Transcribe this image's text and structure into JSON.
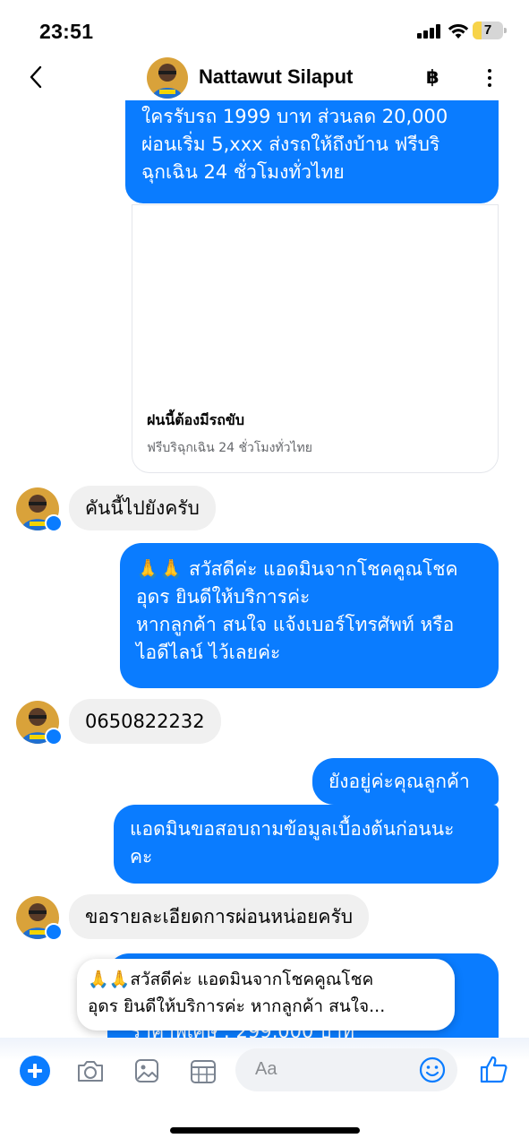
{
  "status_bar": {
    "time": "23:51",
    "battery": "7",
    "battery_level": 0.07
  },
  "header": {
    "contact_name": "Nattawut Silaput",
    "currency_symbol": "฿"
  },
  "messages": {
    "m1": {
      "lines": [
        "ใครรับรถ 1999 บาท ส่วนลด 20,000",
        "ผ่อนเริ่ม 5,xxx ส่งรถให้ถึงบ้าน ฟรีบริ",
        "ฉุกเฉิน 24 ชั่วโมงทั่วไทย"
      ]
    },
    "link_card": {
      "title": "ฝนนี้ต้องมีรถขับ",
      "subtitle": "ฟรีบริฉุกเฉิน 24 ชั่วโมงทั่วไทย"
    },
    "m2": {
      "text": "คันนี้ไปยังครับ"
    },
    "m3": {
      "lines": [
        "🙏🙏 สวัสดีค่ะ แอดมินจากโชคคูณโชค",
        "อุดร ยินดีให้บริการค่ะ",
        "หากลูกค้า สนใจ แจ้งเบอร์โทรศัพท์ หรือ",
        "ไอดีไลน์  ไว้เลยค่ะ"
      ]
    },
    "m4": {
      "text": "0650822232"
    },
    "m5": {
      "text": "ยังอยู่ค่ะคุณลูกค้า"
    },
    "m6": {
      "lines": [
        "แอดมินขอสอบถามข้อมูลเบื้องต้นก่อนนะ",
        "คะ"
      ]
    },
    "m7": {
      "text": "ขอรายละเอียดการผ่อนหน่อยครับ"
    },
    "m8_partial": {
      "text": "ราคาพิเศษ : 299,000 บาท"
    }
  },
  "preview_popup": {
    "lines": [
      "🙏🙏สวัสดีค่ะ แอดมินจากโชคคูณโชค",
      "อุดร ยินดีให้บริการค่ะ หากลูกค้า สนใจ..."
    ]
  },
  "composer": {
    "placeholder": "Aa"
  },
  "colors": {
    "outgoing_bubble": "#0a7cff",
    "incoming_bubble": "#f0f0f0",
    "accent": "#0a7cff"
  },
  "icons": [
    "back-icon",
    "baht-icon",
    "more-icon",
    "plus-icon",
    "camera-icon",
    "gallery-icon",
    "sticker-icon",
    "emoji-icon",
    "like-icon",
    "messenger-badge-icon"
  ]
}
